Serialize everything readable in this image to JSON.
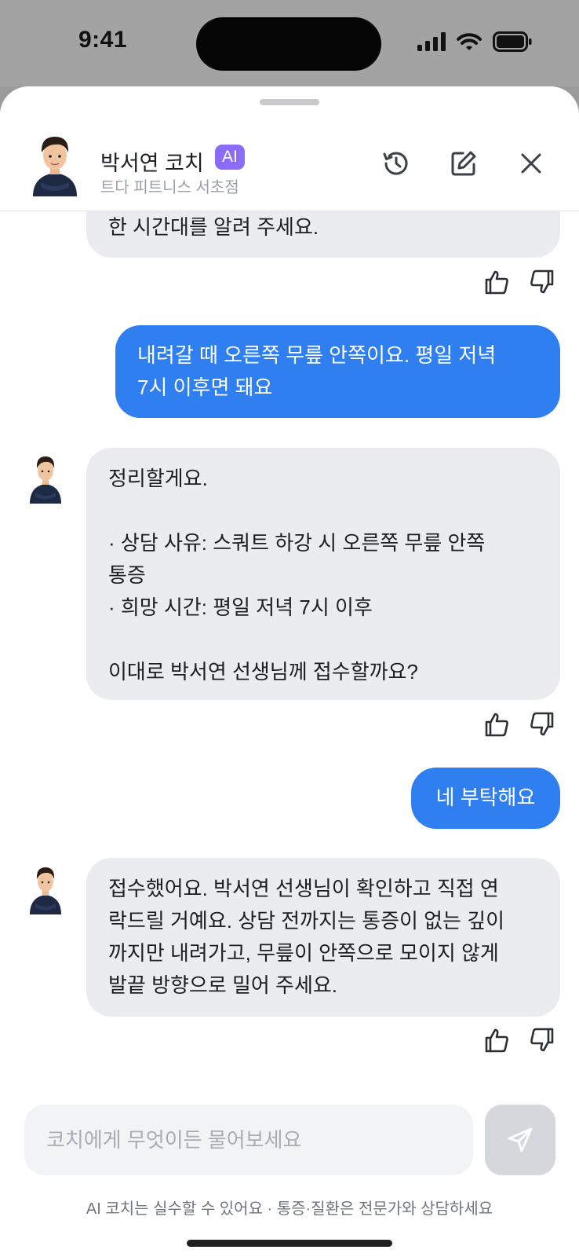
{
  "status_bar": {
    "time": "9:41"
  },
  "header": {
    "coach_name": "박서연 코치",
    "ai_badge": "AI",
    "gym_name": "트다 피트니스 서초점",
    "icons": [
      "history-icon",
      "edit-icon",
      "close-icon"
    ]
  },
  "messages": [
    {
      "role": "coach",
      "text": "한 시간대를 알려 주세요."
    },
    {
      "role": "user",
      "text": "내려갈 때 오른쪽 무릎 안쪽이요. 평일 저녁\n7시 이후면 돼요"
    },
    {
      "role": "coach",
      "text": "정리할게요.\n\n· 상담 사유: 스쿼트 하강 시 오른쪽 무릎 안쪽\n통증\n· 희망 시간: 평일 저녁 7시 이후\n\n이대로 박서연 선생님께 접수할까요?"
    },
    {
      "role": "user",
      "text": "네 부탁해요"
    },
    {
      "role": "coach",
      "text": "접수했어요. 박서연 선생님이 확인하고 직접 연\n락드릴 거예요. 상담 전까지는 통증이 없는 깊이\n까지만 내려가고, 무릎이 안쪽으로 모이지 않게\n발끝 방향으로 밀어 주세요."
    }
  ],
  "feedback_icons": [
    "thumbs-up-icon",
    "thumbs-down-icon"
  ],
  "input": {
    "placeholder": "코치에게 무엇이든 물어보세요",
    "value": ""
  },
  "send_icon": "send-icon",
  "disclaimer": "AI 코치는 실수할 수 있어요 · 통증·질환은 전문가와 상담하세요",
  "colors": {
    "user_bubble": "#2f7ff0",
    "coach_bubble": "#eaecef",
    "ai_badge": "#8b6cf6"
  }
}
